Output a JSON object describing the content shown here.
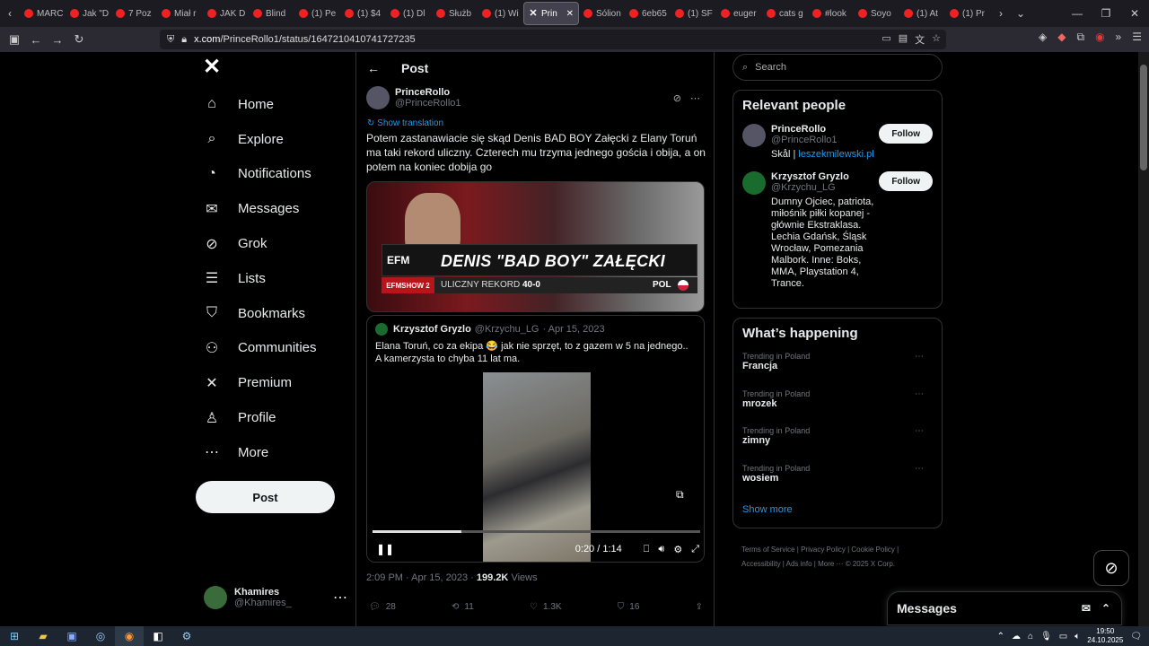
{
  "browser": {
    "tabs": [
      "MARC",
      "Jak \"D",
      "7 Poz",
      "Miał r",
      "JAK D",
      "Blind",
      "(1) Pe",
      "(1) $4",
      "(1) Dl",
      "Służb",
      "(1) Wi",
      "Prin",
      "Sólion",
      "6eb65",
      "(1) SF",
      "euger",
      "cats g",
      "#look",
      "Soyo",
      "(1) At",
      "(1) Pr"
    ],
    "active_tab_index": 11,
    "url_host": "x.com",
    "url_path": "/PrinceRollo1/status/1647210410741727235"
  },
  "nav": {
    "items": [
      {
        "label": "Home",
        "icon": "home-icon",
        "glyph": "⌂"
      },
      {
        "label": "Explore",
        "icon": "search-icon",
        "glyph": "⌕"
      },
      {
        "label": "Notifications",
        "icon": "bell-icon",
        "glyph": "◔"
      },
      {
        "label": "Messages",
        "icon": "mail-icon",
        "glyph": "✉"
      },
      {
        "label": "Grok",
        "icon": "grok-icon",
        "glyph": "⊘"
      },
      {
        "label": "Lists",
        "icon": "list-icon",
        "glyph": "☰"
      },
      {
        "label": "Bookmarks",
        "icon": "bookmark-icon",
        "glyph": "⛉"
      },
      {
        "label": "Communities",
        "icon": "communities-icon",
        "glyph": "⚇"
      },
      {
        "label": "Premium",
        "icon": "x-icon",
        "glyph": "✕"
      },
      {
        "label": "Profile",
        "icon": "profile-icon",
        "glyph": "♙"
      },
      {
        "label": "More",
        "icon": "more-icon",
        "glyph": "⋯"
      }
    ],
    "post_label": "Post",
    "account": {
      "name": "Khamires",
      "handle": "@Khamires_"
    }
  },
  "post": {
    "header": "Post",
    "author_name": "PrinceRollo",
    "author_handle": "@PrinceRollo1",
    "show_translation": "Show translation",
    "text": "Potem zastanawiacie się skąd Denis BAD BOY Załęcki z Elany Toruń ma taki rekord uliczny. Czterech mu trzyma jednego gościa i obija, a on potem na koniec dobija go",
    "media": {
      "logo": "EFM",
      "title": "DENIS \"BAD BOY\" ZAŁĘCKI",
      "show": "EFMSHOW 2",
      "record_label": "ULICZNY REKORD",
      "record_value": "40-0",
      "country": "POL"
    },
    "quote": {
      "name": "Krzysztof Gryzlo",
      "handle": "@Krzychu_LG",
      "date": "· Apr 15, 2023",
      "text_line1": "Elana Toruń, co za ekipa 😂 jak nie sprzęt, to z gazem w 5 na jednego..",
      "text_line2": "A kamerzysta to chyba 11 lat ma.",
      "video_time": "0:20 / 1:14",
      "progress_fraction": 0.27
    },
    "timestamp": "2:09 PM · Apr 15, 2023 · ",
    "views_count": "199.2K",
    "views_label": " Views",
    "actions": {
      "replies": "28",
      "reposts": "11",
      "likes": "1.3K",
      "bookmarks": "16"
    }
  },
  "sidebar": {
    "search_placeholder": "Search",
    "relevant_title": "Relevant people",
    "people": [
      {
        "name": "PrinceRollo",
        "handle": "@PrinceRollo1",
        "bio_prefix": "Skål | ",
        "bio_link": "leszekmilewski.pl",
        "follow": "Follow",
        "avatar_color": "#556"
      },
      {
        "name": "Krzysztof Gryzlo",
        "handle": "@Krzychu_LG",
        "bio_prefix": "Dumny Ojciec, patriota, miłośnik piłki kopanej - głównie Ekstraklasa. Lechia Gdańsk, Śląsk Wrocław, Pomezania Malbork. Inne: Boks, MMA, Playstation 4, Trance.",
        "bio_link": "",
        "follow": "Follow",
        "avatar_color": "#1a6b2e"
      }
    ],
    "happening_title": "What’s happening",
    "trends": [
      {
        "context": "Trending in Poland",
        "topic": "Francja"
      },
      {
        "context": "Trending in Poland",
        "topic": "mrozek"
      },
      {
        "context": "Trending in Poland",
        "topic": "zimny"
      },
      {
        "context": "Trending in Poland",
        "topic": "wosiem"
      }
    ],
    "show_more": "Show more",
    "footer_line1": "Terms of Service  |  Privacy Policy  |  Cookie Policy  |",
    "footer_line2": "Accessibility  |  Ads info  |  More ···  © 2025 X Corp."
  },
  "messages_drawer": {
    "title": "Messages"
  },
  "taskbar": {
    "time": "19:50",
    "date": "24.10.2025"
  }
}
